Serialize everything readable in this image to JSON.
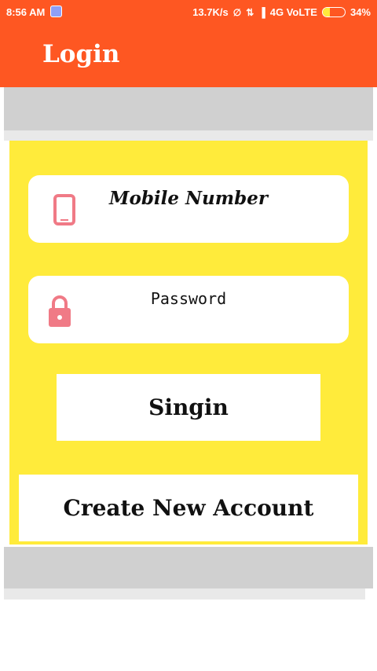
{
  "status_bar": {
    "time": "8:56 AM",
    "speed": "13.7K/s",
    "network": "4G VoLTE",
    "battery": "34%",
    "battery_level": 0.34
  },
  "app_bar": {
    "title": "Login",
    "color": "#fe5722"
  },
  "form": {
    "panel_color": "#ffeb3b",
    "mobile_field": {
      "label": "Mobile Number",
      "icon": "phone-icon"
    },
    "password_field": {
      "label": "Password",
      "icon": "lock-icon"
    },
    "signin_label": "Singin",
    "create_account_label": "Create New Account"
  },
  "colors": {
    "icon_pink": "#f07a86",
    "frame_gray": "#d0d0d0"
  }
}
